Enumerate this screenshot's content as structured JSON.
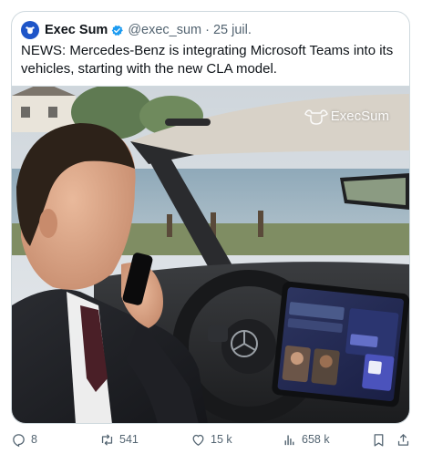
{
  "tweet": {
    "author_name": "Exec Sum",
    "author_handle": "@exec_sum",
    "separator": "·",
    "date": "25 juil.",
    "text": "NEWS: Mercedes-Benz is integrating Microsoft Teams into its vehicles, starting with the new CLA model."
  },
  "media": {
    "watermark": "ExecSum",
    "screen_labels": [
      "Learlund",
      "Contoso",
      "T"
    ]
  },
  "actions": {
    "replies": "8",
    "reposts": "541",
    "likes": "15 k",
    "views": "658 k"
  },
  "colors": {
    "verified": "#1d9bf0",
    "muted_text": "#536471",
    "border": "#cfd9de",
    "avatar_bg": "#1e55c8"
  },
  "icons": [
    "bull-logo-icon",
    "verified-badge-icon",
    "reply-icon",
    "repost-icon",
    "like-icon",
    "views-icon",
    "bookmark-icon",
    "share-icon"
  ]
}
